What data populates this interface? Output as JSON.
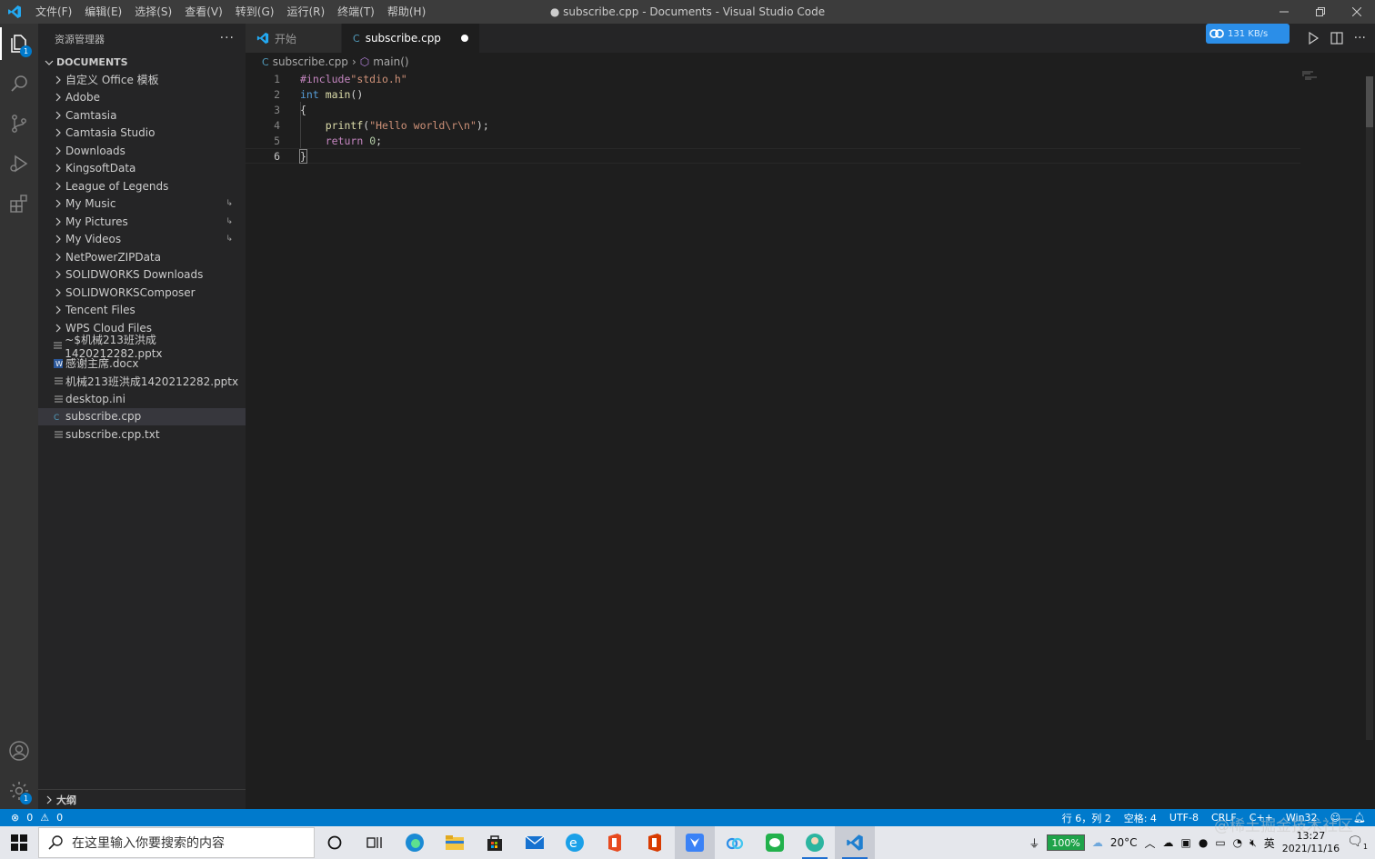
{
  "titlebar": {
    "menus": [
      "文件(F)",
      "编辑(E)",
      "选择(S)",
      "查看(V)",
      "转到(G)",
      "运行(R)",
      "终端(T)",
      "帮助(H)"
    ],
    "title": "● subscribe.cpp - Documents - Visual Studio Code"
  },
  "activitybar": {
    "explorer_badge": "1",
    "settings_badge": "1"
  },
  "sidebar": {
    "header": "资源管理器",
    "more": "···",
    "section": "DOCUMENTS",
    "folders": [
      "自定义 Office 模板",
      "Adobe",
      "Camtasia",
      "Camtasia Studio",
      "Downloads",
      "KingsoftData",
      "League of Legends",
      "My Music",
      "My Pictures",
      "My Videos",
      "NetPowerZIPData",
      "SOLIDWORKS Downloads",
      "SOLIDWORKSComposer",
      "Tencent Files",
      "WPS Cloud Files"
    ],
    "files": [
      "~$机械213班洪成1420212282.pptx",
      "感谢主席.docx",
      "机械213班洪成1420212282.pptx",
      "desktop.ini",
      "subscribe.cpp",
      "subscribe.cpp.txt"
    ],
    "outline": "大纲"
  },
  "tabs": {
    "welcome": "开始",
    "active": "subscribe.cpp",
    "net_speed": "131 KB/s"
  },
  "breadcrumb": {
    "file": "subscribe.cpp",
    "symbol": "main()"
  },
  "editor": {
    "line_numbers": [
      "1",
      "2",
      "3",
      "4",
      "5",
      "6"
    ],
    "l1_pre": "#include",
    "l1_str": "\"stdio.h\"",
    "l2_kw": "int",
    "l2_fn": "main",
    "l2_rest": "()",
    "l3": "{",
    "l4_fn": "printf",
    "l4_open": "(",
    "l4_str": "\"Hello world\\r\\n\"",
    "l4_close": ");",
    "l5_kw": "return",
    "l5_num": "0",
    "l5_semi": ";",
    "l6": "}"
  },
  "statusbar": {
    "errors": "0",
    "warnings": "0",
    "position": "行 6，列 2",
    "spaces": "空格: 4",
    "encoding": "UTF-8",
    "eol": "CRLF",
    "language": "C++",
    "platform": "Win32"
  },
  "taskbar": {
    "search_placeholder": "在这里输入你要搜索的内容",
    "battery": "100%",
    "temperature": "20°C",
    "ime": "英",
    "time": "13:27",
    "date": "2021/11/16",
    "notif_count": "1"
  },
  "watermark": "@稀土掘金技术社区",
  "colors": {
    "accent": "#007acc",
    "editor_bg": "#1e1e1e",
    "sidebar_bg": "#252526",
    "activity_bg": "#333333",
    "titlebar_bg": "#3c3c3c"
  }
}
